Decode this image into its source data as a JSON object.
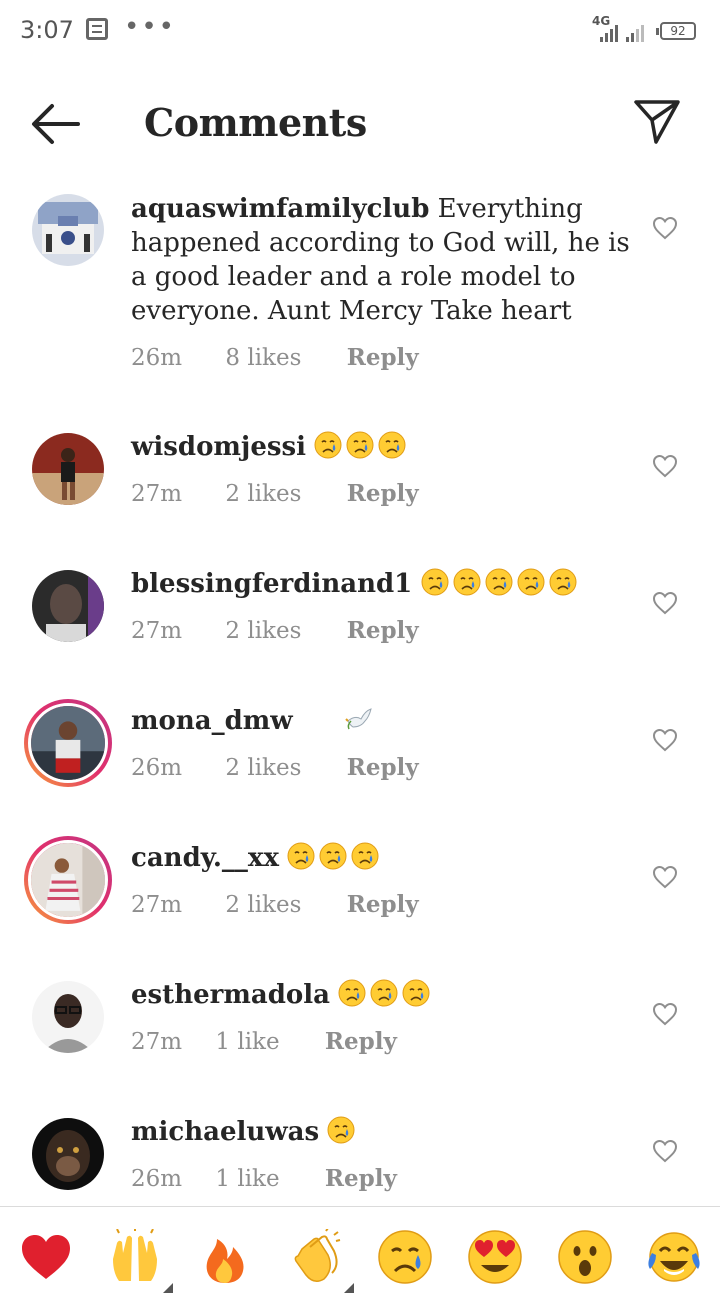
{
  "status_bar": {
    "time": "3:07",
    "network": "4G",
    "battery": "92"
  },
  "header": {
    "title": "Comments"
  },
  "comments": [
    {
      "username": "aquaswimfamilyclub",
      "text": "Everything happened  according to God will, he is a good leader and a role model to everyone. Aunt Mercy Take heart",
      "time": "26m",
      "likes": "8 likes",
      "reply": "Reply",
      "emojis": [],
      "story_ring": false
    },
    {
      "username": "wisdomjessi",
      "text": "",
      "time": "27m",
      "likes": "2 likes",
      "reply": "Reply",
      "emojis": [
        "crying-face",
        "crying-face",
        "crying-face"
      ],
      "story_ring": false
    },
    {
      "username": "blessingferdinand1",
      "text": "",
      "time": "27m",
      "likes": "2 likes",
      "reply": "Reply",
      "emojis": [
        "crying-face",
        "crying-face",
        "crying-face",
        "crying-face",
        "crying-face"
      ],
      "story_ring": false
    },
    {
      "username": "mona_dmw",
      "text": "",
      "time": "26m",
      "likes": "2 likes",
      "reply": "Reply",
      "emojis": [
        "dove"
      ],
      "story_ring": true
    },
    {
      "username": "candy.__xx",
      "text": "",
      "time": "27m",
      "likes": "2 likes",
      "reply": "Reply",
      "emojis": [
        "crying-face",
        "crying-face",
        "crying-face"
      ],
      "story_ring": true
    },
    {
      "username": "esthermadola",
      "text": "",
      "time": "27m",
      "likes": "1 like",
      "reply": "Reply",
      "emojis": [
        "crying-face",
        "crying-face",
        "crying-face"
      ],
      "story_ring": false
    },
    {
      "username": "michaeluwas",
      "text": "",
      "time": "26m",
      "likes": "1 like",
      "reply": "Reply",
      "emojis": [
        "crying-face"
      ],
      "story_ring": false
    }
  ],
  "reactions": [
    "red-heart",
    "raising-hands",
    "fire",
    "clapping-hands",
    "crying-face",
    "heart-eyes",
    "astonished-face",
    "tears-of-joy"
  ],
  "colors": {
    "text": "#262626",
    "meta": "#8e8e8e",
    "heart_red": "#e0202e",
    "emoji_yellow": "#ffcc33",
    "tear_blue": "#3d7fe0"
  }
}
